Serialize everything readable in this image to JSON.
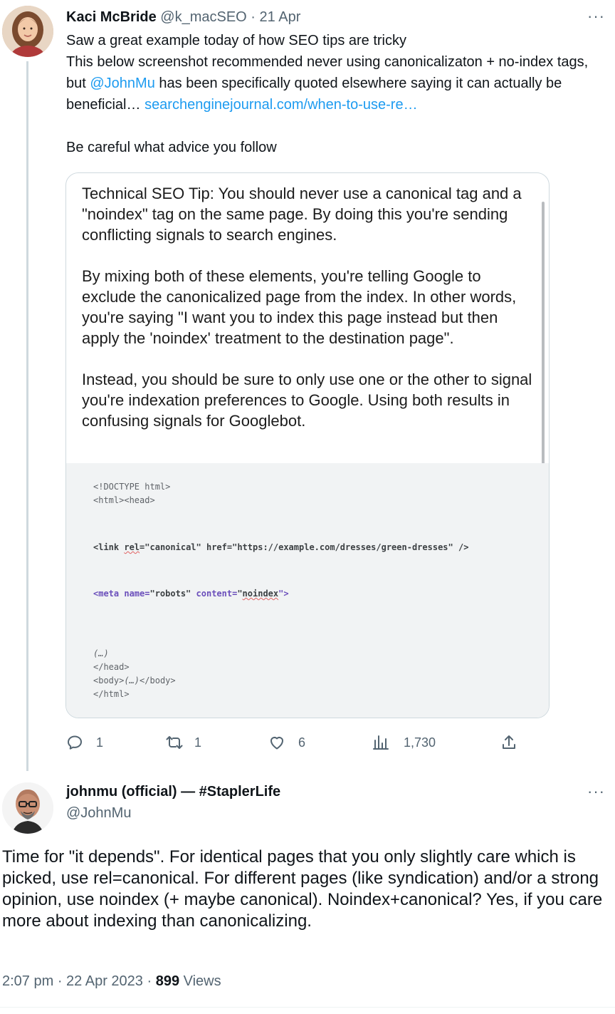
{
  "tweet1": {
    "author_name": "Kaci McBride",
    "author_handle": "@k_macSEO",
    "separator": "·",
    "date": "21 Apr",
    "more_icon": "···",
    "line1": "Saw a great example today of how SEO tips are tricky",
    "line2_prefix": "This below screenshot recommended never using canonicalizaton + no-index tags, but ",
    "mention": "@JohnMu",
    "line2_suffix": " has been specifically quoted elsewhere saying it can actually be beneficial… ",
    "link_text": "searchenginejournal.com/when-to-use-re…",
    "line3": "Be careful what advice you follow",
    "card": {
      "para1": "Technical SEO Tip: You should never use a canonical tag and a \"noindex\" tag on the same page. By doing this you're sending conflicting signals to search engines.",
      "para2": "By mixing both of these elements, you're telling Google to exclude the canonicalized page from the index. In other words, you're saying \"I want you to index this page instead but then apply the 'noindex' treatment to the destination page\".",
      "para3": "Instead, you should be sure to only use one or the other to signal you're indexation preferences to Google. Using both results in confusing signals for Googlebot.",
      "code": {
        "doctype": "<!DOCTYPE html>",
        "html_head": "<html><head>",
        "link_open": "<link ",
        "link_rel_attr": "rel",
        "link_rest": "=\"canonical\" href=\"https://example.com/dresses/green-dresses\" />",
        "meta_tag": "<meta ",
        "meta_name": "name=",
        "meta_name_val": "\"robots\" ",
        "meta_content": "content=",
        "meta_content_open": "\"",
        "meta_content_val": "noindex",
        "meta_content_close": "\">",
        "ellipsis": "(…)",
        "head_close": "</head>",
        "body_open": "<body>",
        "body_ellipsis": "(…)",
        "body_close": "</body>",
        "html_close": "</html>"
      }
    },
    "actions": {
      "replies": "1",
      "retweets": "1",
      "likes": "6",
      "views": "1,730"
    }
  },
  "tweet2": {
    "author_name": "johnmu (official) — #StaplerLife",
    "author_handle": "@JohnMu",
    "more_icon": "···",
    "text": "Time for \"it depends\". For identical pages that you only slightly care which is picked, use rel=canonical. For different pages (like syndication) and/or a strong opinion, use noindex (+ maybe canonical). Noindex+canonical? Yes, if you care more about indexing than canonicalizing.",
    "time": "2:07 pm",
    "separator1": " · ",
    "date": "22 Apr 2023",
    "separator2": " · ",
    "views_count": "899",
    "views_label": " Views"
  },
  "colors": {
    "link": "#1d9bf0",
    "muted": "#536471",
    "text": "#0f1419"
  }
}
